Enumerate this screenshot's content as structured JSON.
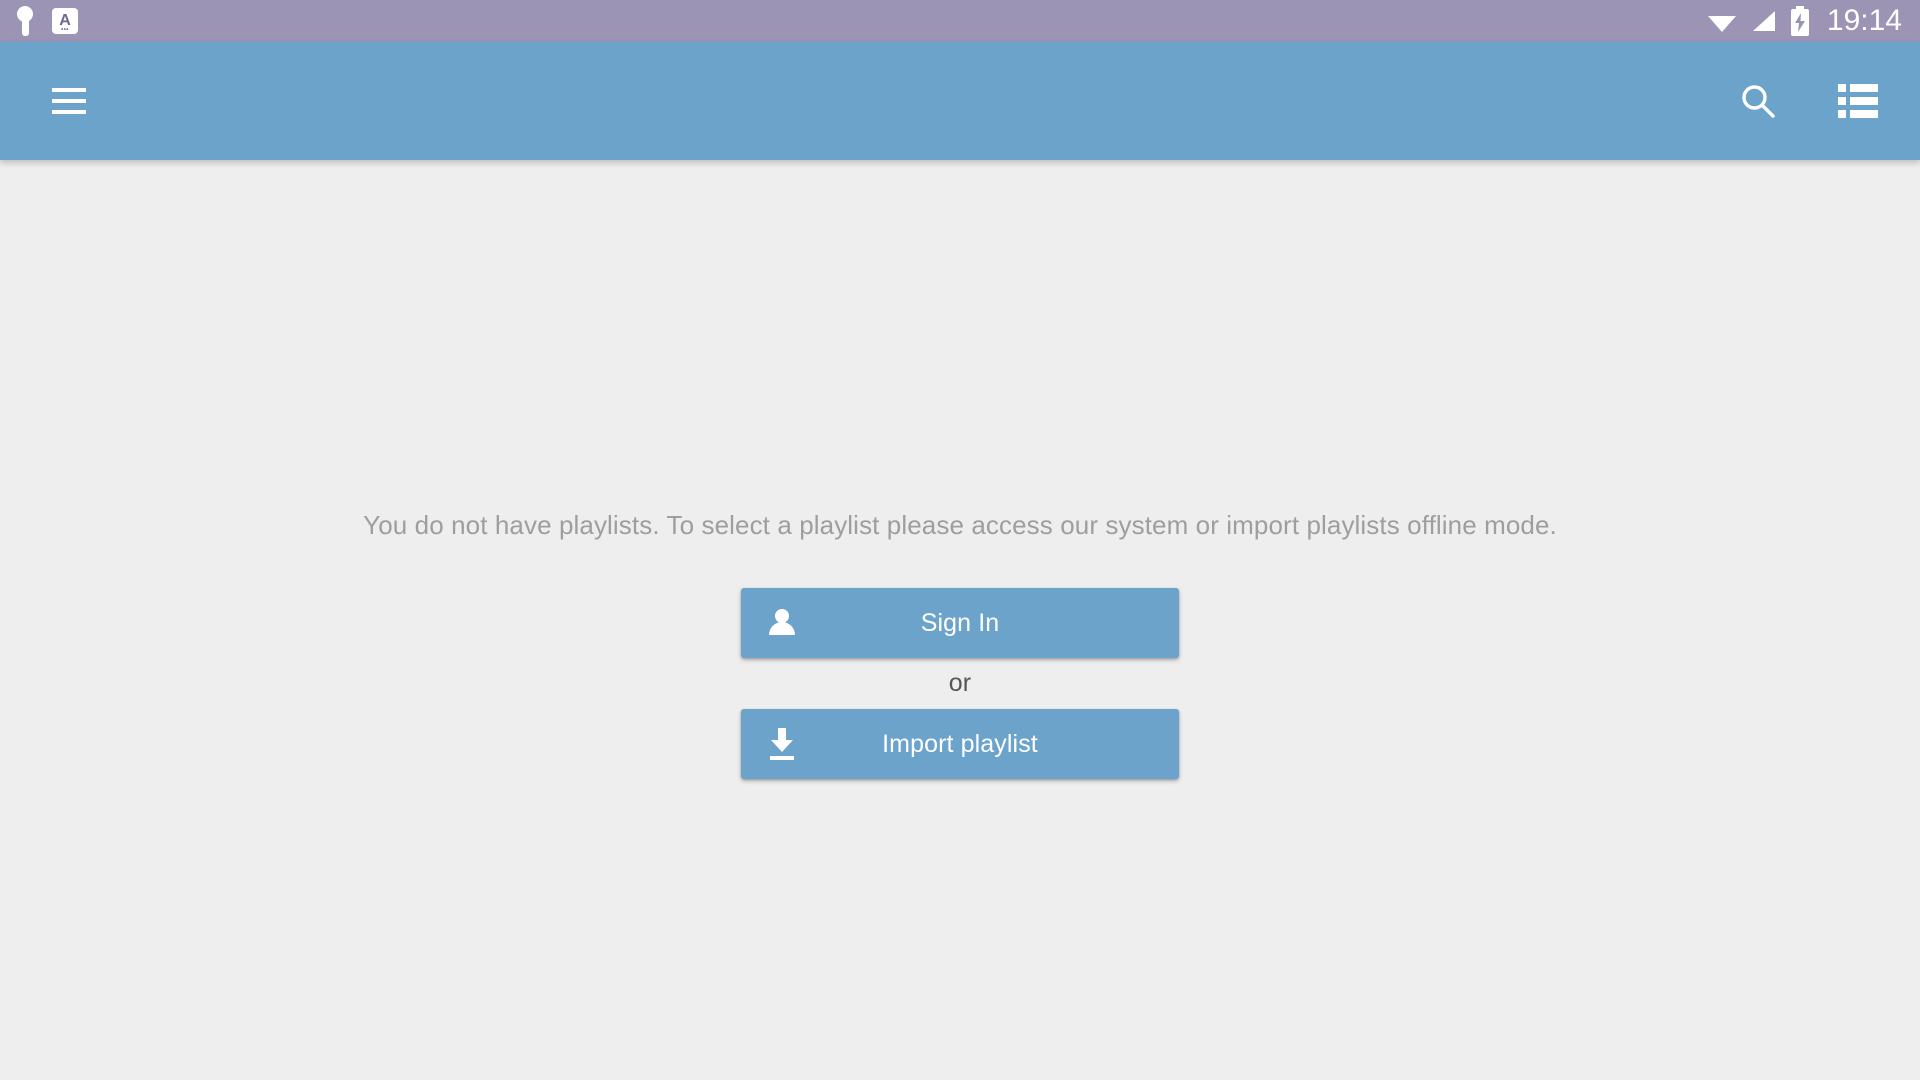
{
  "status_bar": {
    "left_icons": [
      {
        "name": "vpn-key-icon",
        "label": "VPN key"
      },
      {
        "name": "translate-icon",
        "label": "A"
      }
    ],
    "right_icons": [
      {
        "name": "wifi-icon",
        "label": "WiFi connected"
      },
      {
        "name": "signal-icon",
        "label": "Mobile signal"
      },
      {
        "name": "battery-charging-icon",
        "label": "Battery charging"
      }
    ],
    "time": "19:14",
    "background_color": "#9b94b5",
    "icon_color": "#ffffff"
  },
  "app_bar": {
    "menu_icon": "hamburger-menu-icon",
    "actions": [
      {
        "name": "search-icon",
        "label": "Search"
      },
      {
        "name": "list-view-icon",
        "label": "List view"
      }
    ],
    "title": "",
    "background_color": "#6ba3ca"
  },
  "main": {
    "empty_state_message": "You do not have playlists. To select a playlist please access our system or import playlists offline mode.",
    "message_color": "#9e9e9e",
    "background_color": "#eeeeee",
    "sign_in_button": {
      "label": "Sign In",
      "icon": "person-icon",
      "background_color": "#6ba3ca",
      "text_color": "#ffffff"
    },
    "separator_label": "or",
    "separator_color": "#555555",
    "import_button": {
      "label": "Import playlist",
      "icon": "download-icon",
      "background_color": "#6ba3ca",
      "text_color": "#ffffff"
    }
  }
}
